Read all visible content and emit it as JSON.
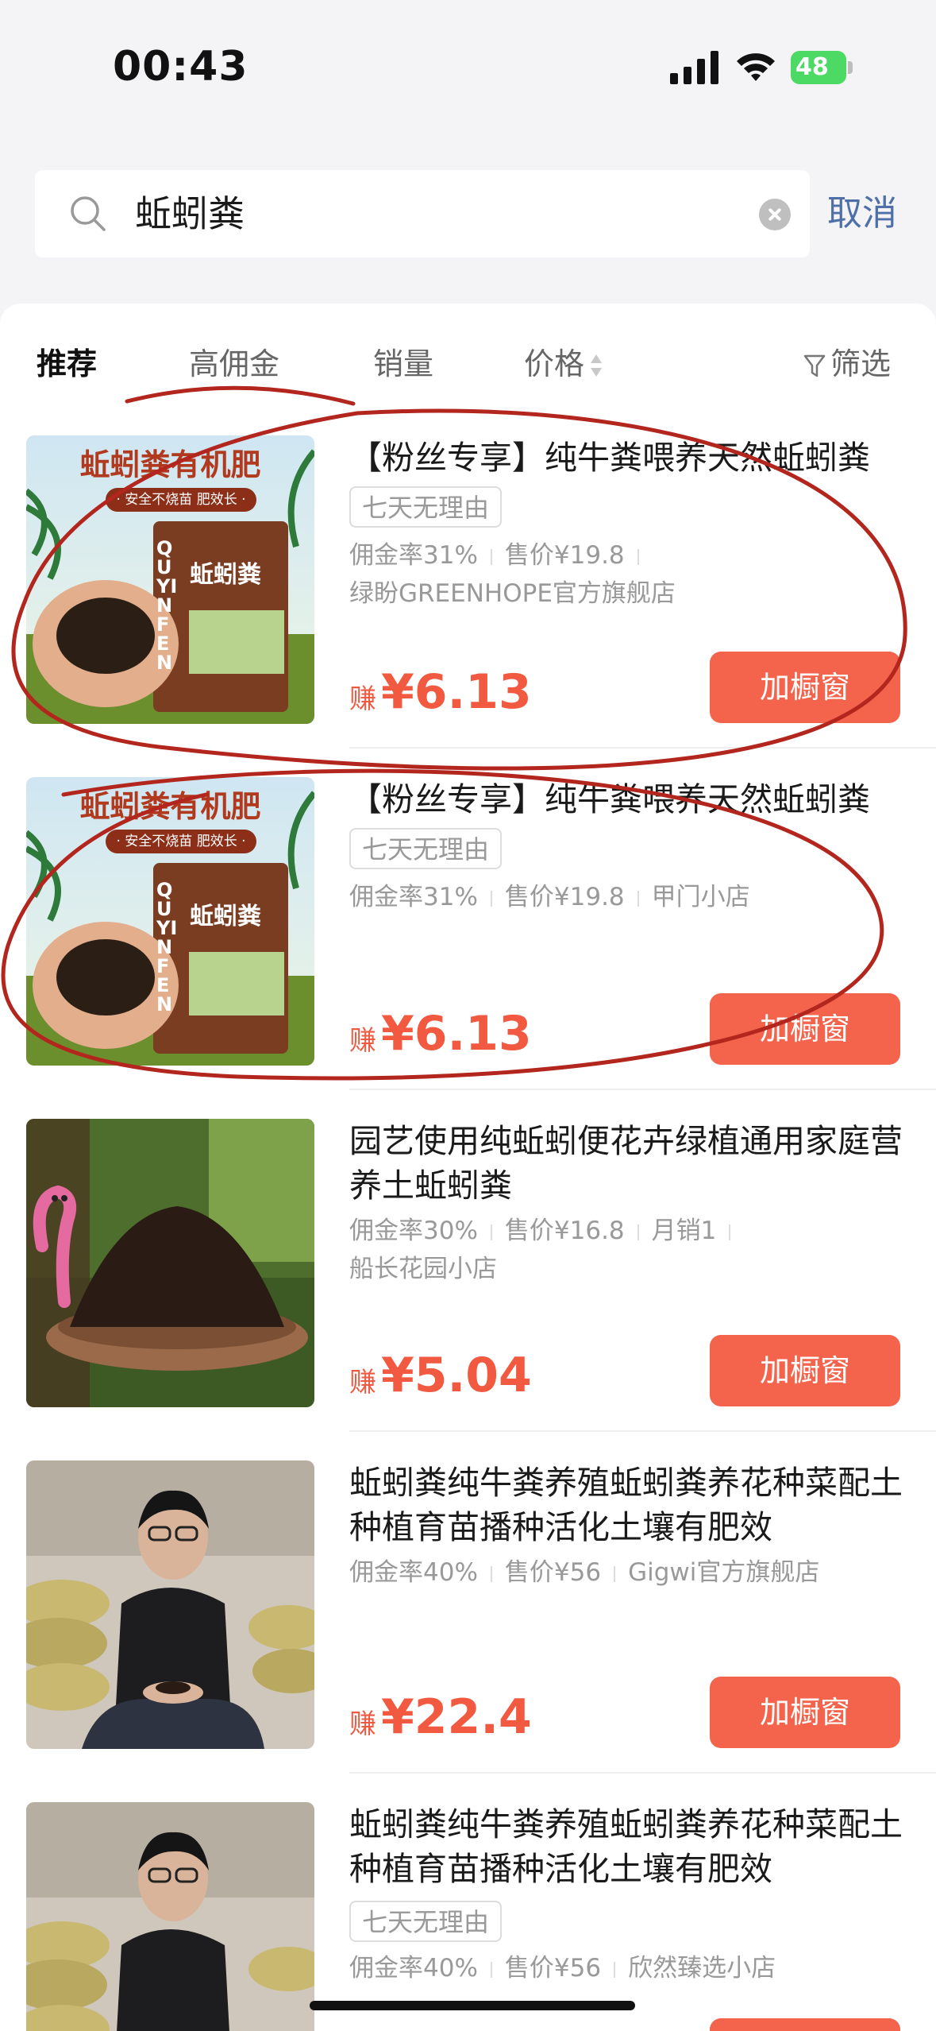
{
  "status_bar": {
    "time": "00:43",
    "battery": "48"
  },
  "search": {
    "query": "蚯蚓粪",
    "cancel_label": "取消"
  },
  "tabs": [
    {
      "label": "推荐"
    },
    {
      "label": "高佣金"
    },
    {
      "label": "销量"
    },
    {
      "label": "价格"
    },
    {
      "label": "筛选"
    }
  ],
  "products": [
    {
      "title": "【粉丝专享】纯牛粪喂养天然蚯蚓粪",
      "tag": "七天无理由",
      "commission": "佣金率31%",
      "price": "售价¥19.8",
      "shop": "绿盼GREENHOPE官方旗舰店",
      "earn_label": "赚",
      "earn": "¥6.13",
      "button": "加橱窗",
      "image": {
        "headline": "蚯蚓粪有机肥",
        "slogan": "· 安全不烧苗 肥效长 ·",
        "bag_brand": "QUYINFEN",
        "bag_name": "蚯蚓粪"
      }
    },
    {
      "title": "【粉丝专享】纯牛粪喂养天然蚯蚓粪",
      "tag": "七天无理由",
      "commission": "佣金率31%",
      "price": "售价¥19.8",
      "shop": "甲门小店",
      "earn_label": "赚",
      "earn": "¥6.13",
      "button": "加橱窗",
      "image": {
        "headline": "蚯蚓粪有机肥",
        "slogan": "· 安全不烧苗 肥效长 ·",
        "bag_brand": "QUYINFEN",
        "bag_name": "蚯蚓粪"
      }
    },
    {
      "title": "园艺使用纯蚯蚓便花卉绿植通用家庭营养土蚯蚓粪",
      "commission": "佣金率30%",
      "price": "售价¥16.8",
      "sales": "月销1",
      "shop": "船长花园小店",
      "earn_label": "赚",
      "earn": "¥5.04",
      "button": "加橱窗"
    },
    {
      "title": "蚯蚓粪纯牛粪养殖蚯蚓粪养花种菜配土种植育苗播种活化土壤有肥效",
      "commission": "佣金率40%",
      "price": "售价¥56",
      "shop": "Gigwi官方旗舰店",
      "earn_label": "赚",
      "earn": "¥22.4",
      "button": "加橱窗"
    },
    {
      "title": "蚯蚓粪纯牛粪养殖蚯蚓粪养花种菜配土种植育苗播种活化土壤有肥效",
      "tag": "七天无理由",
      "commission": "佣金率40%",
      "price": "售价¥56",
      "shop": "欣然臻选小店"
    }
  ],
  "colors": {
    "accent": "#f4634b",
    "price": "#f15a40",
    "cancel": "#4e6fa8",
    "annotation": "#b3261e"
  }
}
